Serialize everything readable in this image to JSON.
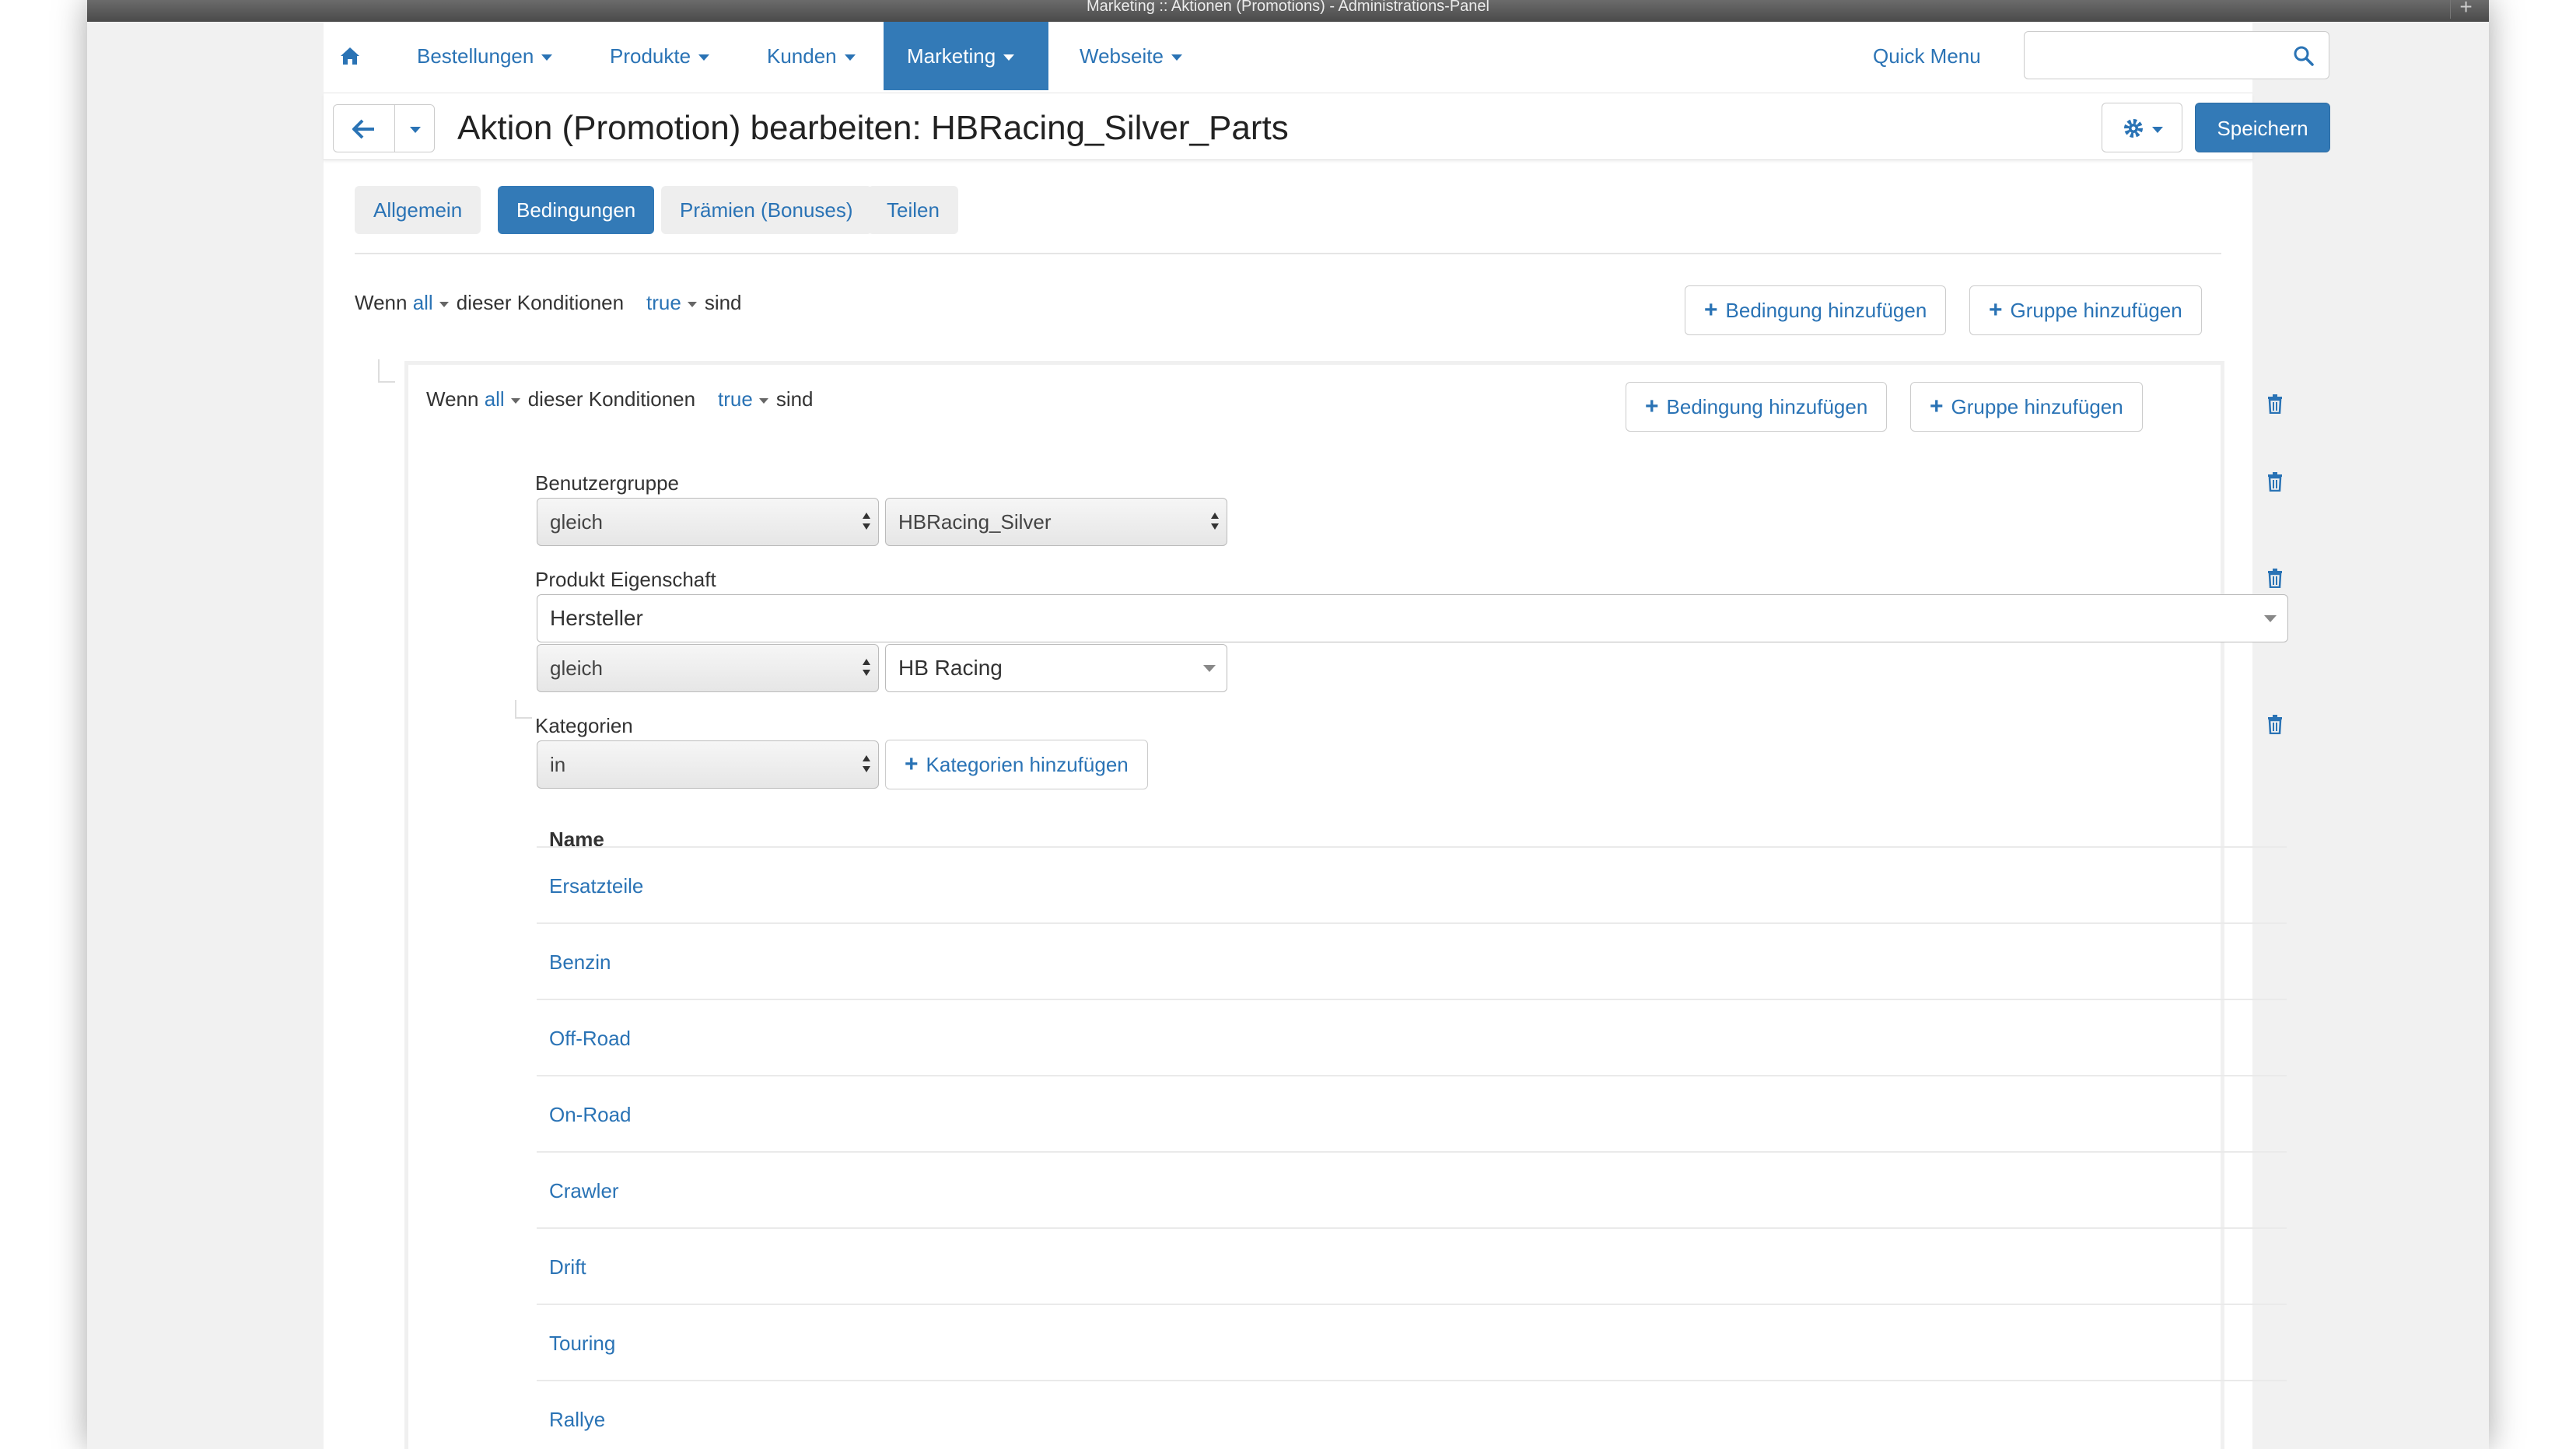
{
  "window": {
    "title": "Marketing :: Aktionen (Promotions) - Administrations-Panel"
  },
  "nav": {
    "items": [
      {
        "label": "Bestellungen"
      },
      {
        "label": "Produkte"
      },
      {
        "label": "Kunden"
      },
      {
        "label": "Marketing"
      },
      {
        "label": "Webseite"
      }
    ],
    "quick_menu": "Quick Menu",
    "search_placeholder": ""
  },
  "header": {
    "title": "Aktion (Promotion) bearbeiten: HBRacing_Silver_Parts",
    "save_label": "Speichern"
  },
  "tabs": [
    {
      "label": "Allgemein"
    },
    {
      "label": "Bedingungen"
    },
    {
      "label": "Prämien (Bonuses)"
    },
    {
      "label": "Teilen"
    }
  ],
  "outer_condition": {
    "prefix": "Wenn",
    "mode": "all",
    "middle": "dieser Konditionen",
    "value": "true",
    "suffix": "sind",
    "add_condition": "Bedingung hinzufügen",
    "add_group": "Gruppe hinzufügen"
  },
  "inner_condition": {
    "prefix": "Wenn",
    "mode": "all",
    "middle": "dieser Konditionen",
    "value": "true",
    "suffix": "sind",
    "add_condition": "Bedingung hinzufügen",
    "add_group": "Gruppe hinzufügen"
  },
  "usergroup": {
    "label": "Benutzergruppe",
    "operator": "gleich",
    "value": "HBRacing_Silver"
  },
  "product_feature": {
    "label": "Produkt Eigenschaft",
    "feature": "Hersteller",
    "operator": "gleich",
    "value": "HB Racing"
  },
  "categories": {
    "label": "Kategorien",
    "operator": "in",
    "add_label": "Kategorien hinzufügen",
    "column_name": "Name",
    "items": [
      "Ersatzteile",
      "Benzin",
      "Off-Road",
      "On-Road",
      "Crawler",
      "Drift",
      "Touring",
      "Rallye"
    ]
  },
  "colors": {
    "accent": "#337ab7",
    "link": "#2a73b5"
  }
}
